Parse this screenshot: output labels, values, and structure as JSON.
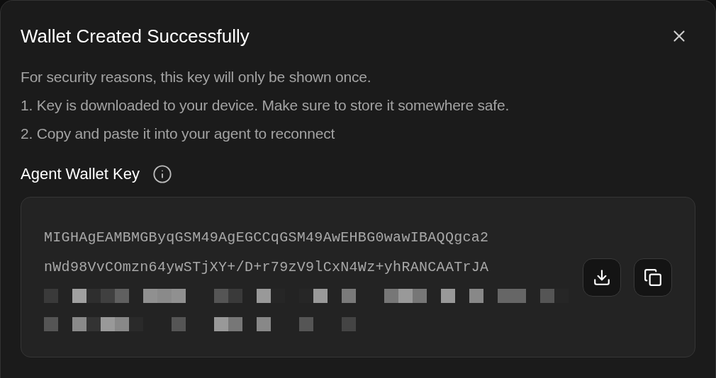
{
  "dialog": {
    "title": "Wallet Created Successfully",
    "instructions": [
      "For security reasons, this key will only be shown once.",
      "1. Key is downloaded to your device. Make sure to store it somewhere safe.",
      "2. Copy and paste it into your agent to reconnect"
    ],
    "key_label": "Agent Wallet Key",
    "key_lines": [
      "MIGHAgEAMBMGByqGSM49AgEGCCqGSM49AwEHBG0wawIBAQQgca2",
      "nWd98VvCOmzn64ywSTjXY+/D+r79zV9lCxN4Wz+yhRANCAATrJA"
    ]
  }
}
